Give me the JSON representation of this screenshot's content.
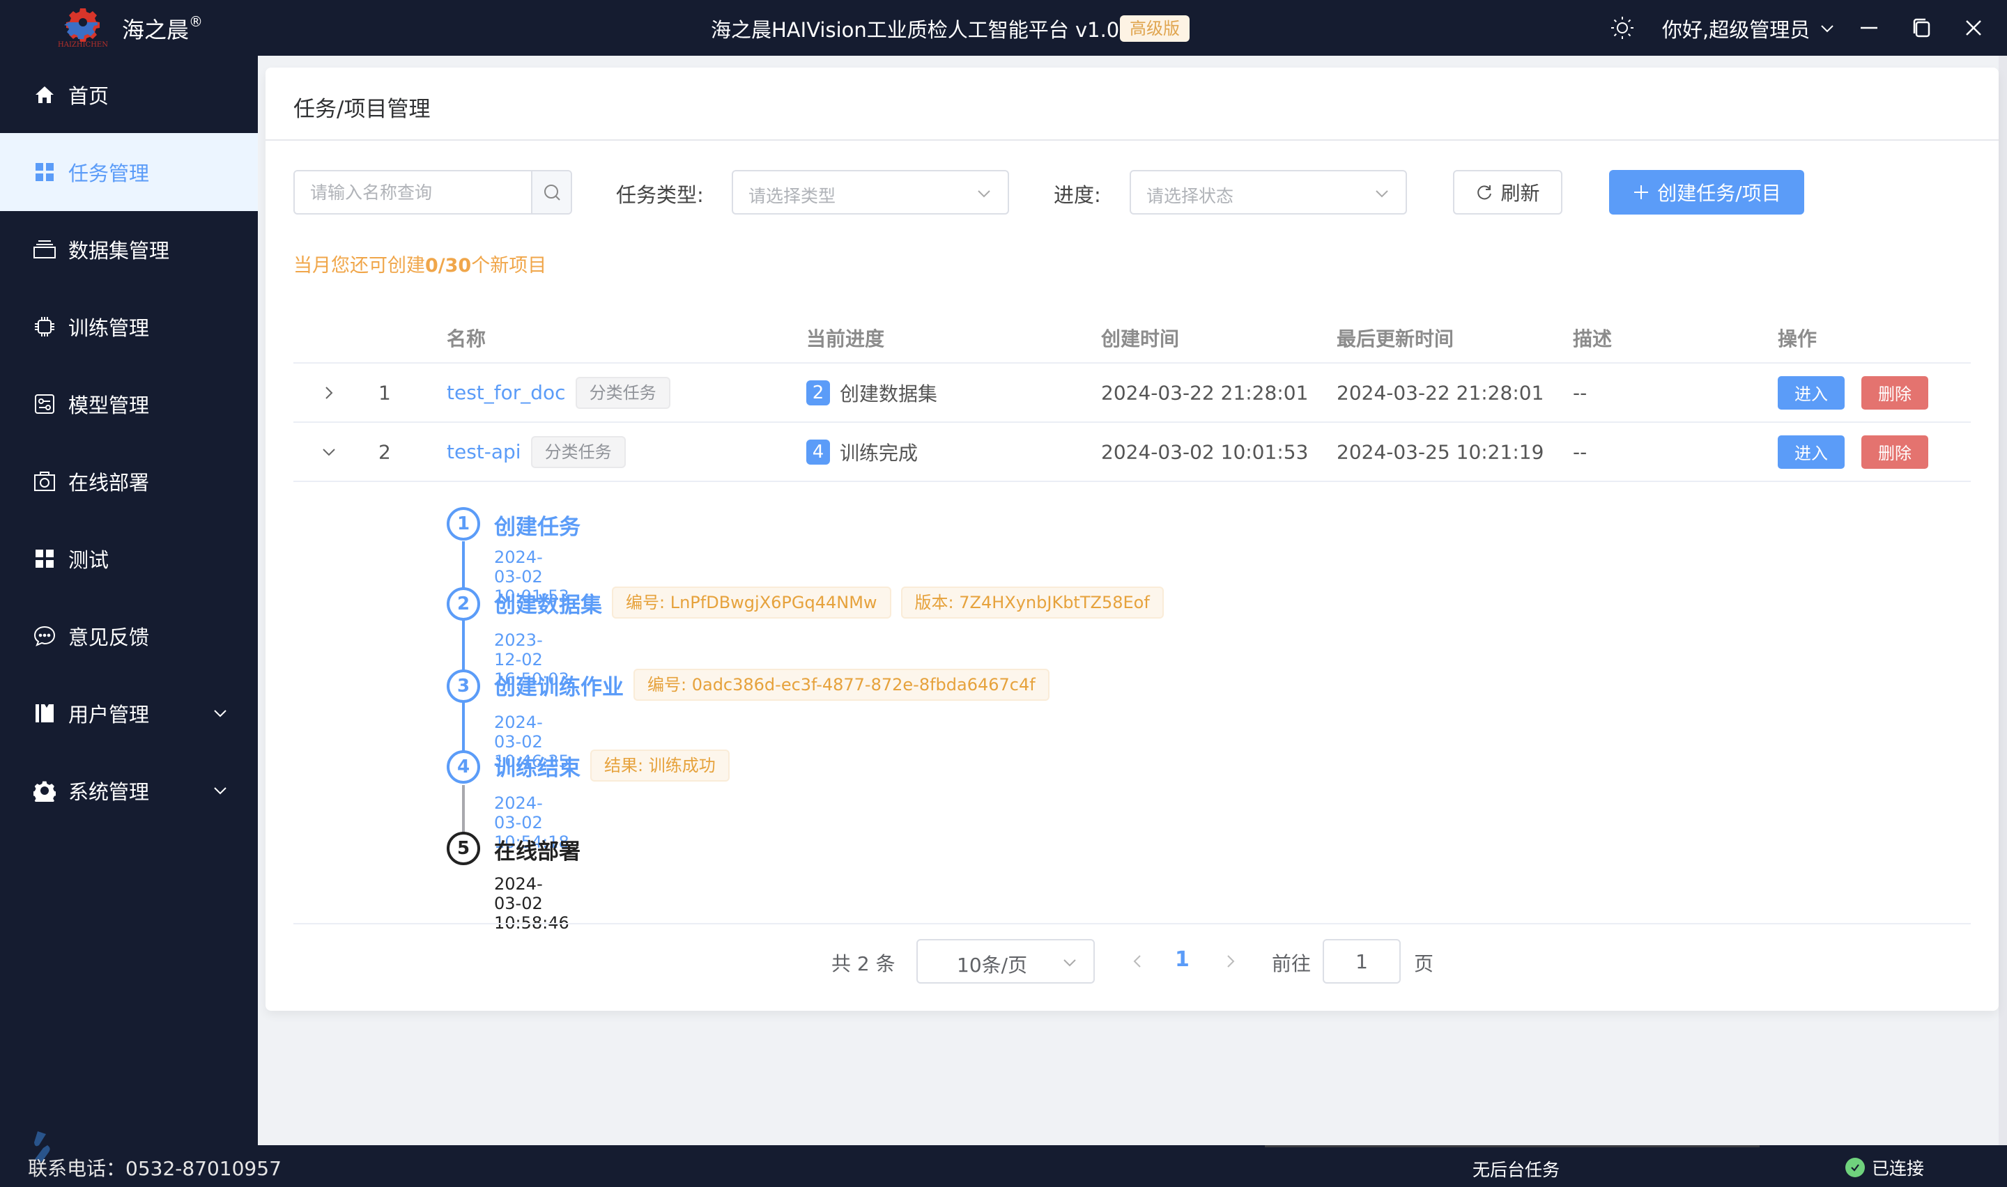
{
  "header": {
    "brand": "海之晨",
    "brand_mark": "®",
    "logo_text": "HAIZHICHEN",
    "app_title": "海之晨HAIVision工业质检人工智能平台 v1.0",
    "edition_badge": "高级版",
    "user_greeting": "你好,超级管理员",
    "icons": [
      "sun-icon",
      "chevron-down-icon",
      "minimize-icon",
      "restore-icon",
      "close-icon"
    ]
  },
  "sidebar": {
    "items": [
      {
        "label": "首页",
        "icon": "home-icon",
        "active": false
      },
      {
        "label": "任务管理",
        "icon": "grid-icon",
        "active": true
      },
      {
        "label": "数据集管理",
        "icon": "dataset-icon",
        "active": false
      },
      {
        "label": "训练管理",
        "icon": "chip-icon",
        "active": false
      },
      {
        "label": "模型管理",
        "icon": "model-icon",
        "active": false
      },
      {
        "label": "在线部署",
        "icon": "camera-icon",
        "active": false
      },
      {
        "label": "测试",
        "icon": "grid-icon",
        "active": false
      },
      {
        "label": "意见反馈",
        "icon": "chat-icon",
        "active": false
      },
      {
        "label": "用户管理",
        "icon": "user-book-icon",
        "active": false,
        "expandable": true
      },
      {
        "label": "系统管理",
        "icon": "gear-icon",
        "active": false,
        "expandable": true
      }
    ]
  },
  "page": {
    "title": "任务/项目管理",
    "filters": {
      "search_placeholder": "请输入名称查询",
      "type_label": "任务类型:",
      "type_placeholder": "请选择类型",
      "progress_label": "进度:",
      "progress_placeholder": "请选择状态",
      "refresh_label": "刷新",
      "create_label": "创建任务/项目"
    },
    "quota": {
      "prefix": "当月您还可创建",
      "value": "0/30",
      "suffix": "个新项目"
    },
    "table": {
      "columns": [
        "名称",
        "当前进度",
        "创建时间",
        "最后更新时间",
        "描述",
        "操作"
      ],
      "rows": [
        {
          "index": "1",
          "name": "test_for_doc",
          "type_tag": "分类任务",
          "progress_step": "2",
          "progress_label": "创建数据集",
          "created": "2024-03-22 21:28:01",
          "updated": "2024-03-22 21:28:01",
          "description": "--",
          "expanded": false
        },
        {
          "index": "2",
          "name": "test-api",
          "type_tag": "分类任务",
          "progress_step": "4",
          "progress_label": "训练完成",
          "created": "2024-03-02 10:01:53",
          "updated": "2024-03-25 10:21:19",
          "description": "--",
          "expanded": true
        }
      ],
      "actions": {
        "enter": "进入",
        "delete": "删除"
      }
    },
    "timeline": [
      {
        "num": "1",
        "title": "创建任务",
        "time": "2024-03-02 10:01:53",
        "tags": [],
        "done": true
      },
      {
        "num": "2",
        "title": "创建数据集",
        "time": "2023-12-02 16:50:03",
        "tags": [
          "编号: LnPfDBwgjX6PGq44NMw",
          "版本: 7Z4HXynbJKbtTZ58Eof"
        ],
        "done": true
      },
      {
        "num": "3",
        "title": "创建训练作业",
        "time": "2024-03-02 10:46:35",
        "tags": [
          "编号: 0adc386d-ec3f-4877-872e-8fbda6467c4f"
        ],
        "done": true
      },
      {
        "num": "4",
        "title": "训练结束",
        "time": "2024-03-02 10:54:18",
        "tags": [
          "结果: 训练成功"
        ],
        "done": true
      },
      {
        "num": "5",
        "title": "在线部署",
        "time": "2024-03-02 10:58:46",
        "tags": [],
        "done": false
      }
    ],
    "pagination": {
      "total": "共 2 条",
      "page_size": "10条/页",
      "current_page": "1",
      "goto_label": "前往",
      "goto_value": "1",
      "page_suffix": "页"
    }
  },
  "footer": {
    "phone": "联系电话：0532-87010957",
    "background_task": "无后台任务",
    "connection": "已连接"
  },
  "colors": {
    "primary": "#5b9cf8",
    "danger": "#e4736f",
    "warning": "#e6a23c",
    "nav_bg": "#151c30",
    "success": "#6fd27d"
  }
}
